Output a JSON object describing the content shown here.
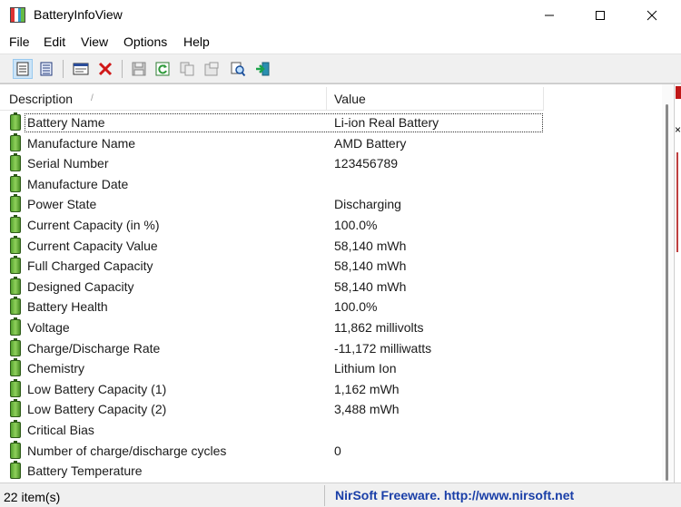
{
  "window": {
    "title": "BatteryInfoView"
  },
  "menu": [
    "File",
    "Edit",
    "View",
    "Options",
    "Help"
  ],
  "toolbar": {
    "buttons": [
      {
        "name": "properties-view-icon"
      },
      {
        "name": "html-report-icon"
      },
      {
        "name": "properties-window-icon"
      },
      {
        "name": "delete-icon"
      },
      {
        "name": "save-icon"
      },
      {
        "name": "refresh-icon"
      },
      {
        "name": "copy-icon"
      },
      {
        "name": "properties-icon"
      },
      {
        "name": "find-icon"
      },
      {
        "name": "exit-icon"
      }
    ]
  },
  "list": {
    "columns": [
      "Description",
      "Value"
    ],
    "rows": [
      {
        "description": "Battery Name",
        "value": "Li-ion Real Battery"
      },
      {
        "description": "Manufacture Name",
        "value": "AMD Battery"
      },
      {
        "description": "Serial Number",
        "value": "123456789"
      },
      {
        "description": "Manufacture Date",
        "value": ""
      },
      {
        "description": "Power State",
        "value": "Discharging"
      },
      {
        "description": "Current Capacity (in %)",
        "value": "100.0%"
      },
      {
        "description": "Current Capacity Value",
        "value": "58,140 mWh"
      },
      {
        "description": "Full Charged Capacity",
        "value": "58,140 mWh"
      },
      {
        "description": "Designed Capacity",
        "value": "58,140 mWh"
      },
      {
        "description": "Battery Health",
        "value": "100.0%"
      },
      {
        "description": "Voltage",
        "value": "11,862 millivolts"
      },
      {
        "description": "Charge/Discharge Rate",
        "value": "-11,172 milliwatts"
      },
      {
        "description": "Chemistry",
        "value": "Lithium Ion"
      },
      {
        "description": "Low Battery Capacity (1)",
        "value": "1,162 mWh"
      },
      {
        "description": "Low Battery Capacity (2)",
        "value": "3,488 mWh"
      },
      {
        "description": "Critical Bias",
        "value": ""
      },
      {
        "description": "Number of charge/discharge cycles",
        "value": "0"
      },
      {
        "description": "Battery Temperature",
        "value": ""
      }
    ]
  },
  "status": {
    "item_count": "22 item(s)",
    "credit": "NirSoft Freeware.  http://www.nirsoft.net"
  },
  "colors": {
    "battery_icon": "#6bb83a",
    "credit_text": "#1a3fa8",
    "toolbar_bg": "#f0f0f0"
  }
}
